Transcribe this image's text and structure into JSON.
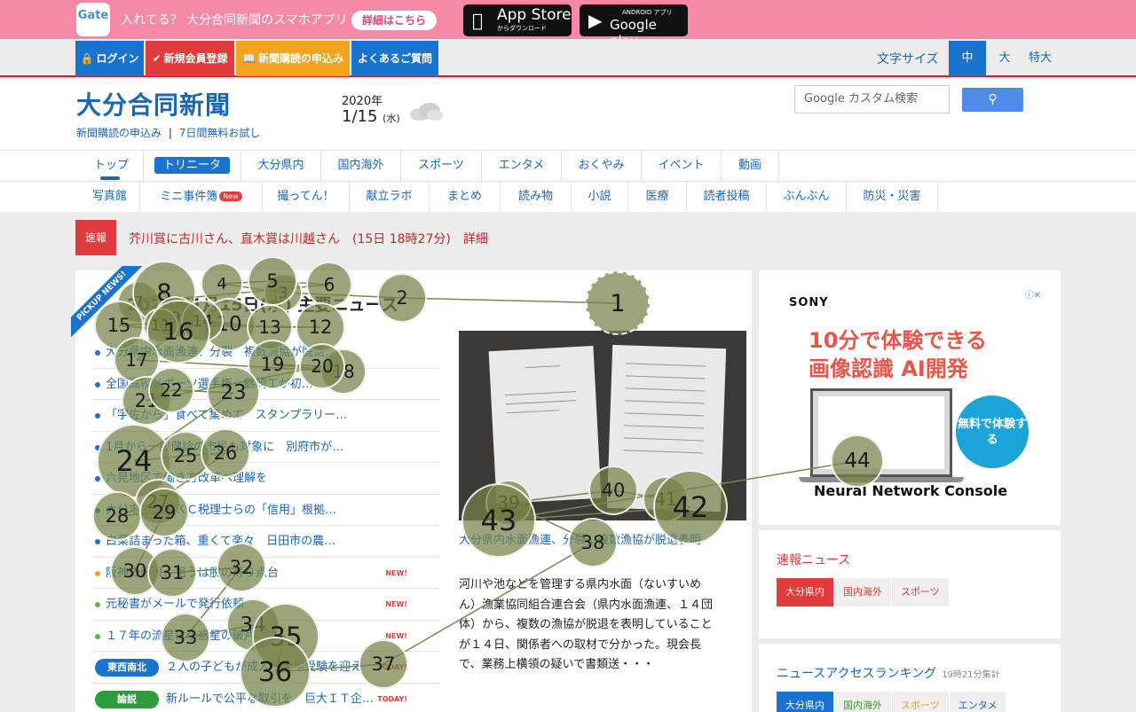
{
  "app_banner": {
    "gate_logo": "Gate",
    "text": "入れてる？ 大分合同新聞のスマホアプリ",
    "detail_button": "詳細はこちら",
    "app_store_main": "App Store",
    "app_store_sub": "からダウンロード",
    "google_play_sub": "ANDROID アプリ",
    "google_play_main": "Google play"
  },
  "top_nav": {
    "login": "ログイン",
    "register": "新規会員登録",
    "subscribe": "新聞購読の申込み",
    "faq": "よくあるご質問",
    "font_size_label": "文字サイズ",
    "font_sizes": [
      "中",
      "大",
      "特大"
    ]
  },
  "header": {
    "logo": "大分合同新聞",
    "sub_link_1": "新聞購読の申込み",
    "sub_link_2": "7日間無料お試し",
    "separator": "|",
    "year": "2020年",
    "date": "1/15",
    "weekday": "(水)",
    "search_placeholder": "カスタム検索",
    "search_brand": "Google",
    "search_button_icon": "search-icon"
  },
  "category_nav_1": [
    "トップ",
    "トリニータ",
    "大分県内",
    "国内海外",
    "スポーツ",
    "エンタメ",
    "おくやみ",
    "イベント",
    "動画"
  ],
  "category_nav_2": [
    "写真館",
    "ミニ事件簿",
    "撮ってん！",
    "献立ラボ",
    "まとめ",
    "読み物",
    "小説",
    "医療",
    "読者投稿",
    "ぶんぶん",
    "防災・災害"
  ],
  "new_badge": "New",
  "breaking": {
    "tag": "速報",
    "text": "芥川賞に古川さん、直木賞は川越さん　(15日 18時27分)",
    "detail": "詳細"
  },
  "pickup": {
    "ribbon": "PICKUP NEWS!",
    "title": "2020年1月15日(水) 主要ニュース",
    "items": [
      {
        "text": "大分県内水面漁連、分裂　複数漁協が脱退…"
      },
      {
        "text": "全国高校スポーツ選手権　鶴崎工が初…"
      },
      {
        "text": "「宇佐から」食べて集めて　スタンプラリー…"
      },
      {
        "text": "1月から一般健診の市民も対象に　別府市が…"
      },
      {
        "text": "六見地区で働き方改革へ理解を"
      },
      {
        "text": "大分市で　ＴＫＣ税理士らの「信用」根拠…"
      },
      {
        "text": "白菜詰まった箱、重くて楽々　日田市の農…"
      },
      {
        "text": "阪神の藤浪、狙うは脱の寿り点台",
        "new": "NEW!"
      },
      {
        "text": "元秘書がメールで発行依頼",
        "new": "NEW!"
      },
      {
        "text": "１７年の流星は小惑星の破片",
        "new": "NEW!"
      },
      {
        "text": "２人の子どもが成人・大学受験を迎え",
        "tag": "東西南北",
        "new": "TODAY!"
      },
      {
        "text": "新ルールで公平な取引を　巨大ＩＴ企…",
        "tag": "論説",
        "new": "TODAY!"
      }
    ],
    "photo_caption": "大分県内水面漁連、分裂　複数漁協が脱退表明",
    "photo_desc": "河川や池などを管理する県内水面（ないすいめん）漁業協同組合連合会（県内水面漁連、１４団体）から、複数の漁協が脱退を表明していることが１４日、関係者への取材で分かった。現会長で、業務上横領の疑いで書類送・・・"
  },
  "ad": {
    "brand": "SONY",
    "headline_1": "10分で体験できる",
    "headline_2": "画像認識 AI開発",
    "cta": "無料で体験する",
    "product": "Neural Network Console",
    "adchoices": "ⓘ✕"
  },
  "breaking_news_box": {
    "title": "速報ニュース",
    "tabs": [
      "大分県内",
      "国内海外",
      "スポーツ"
    ]
  },
  "ranking_box": {
    "title": "ニュースアクセスランキング",
    "subtitle": "19時21分集計",
    "tabs": [
      "大分県内",
      "国内海外",
      "スポーツ",
      "エンタメ"
    ]
  },
  "gaze_fixations": [
    "1",
    "2",
    "3",
    "4",
    "5",
    "6",
    "7",
    "8",
    "9",
    "10",
    "11",
    "12",
    "13",
    "14",
    "15",
    "16",
    "17",
    "18",
    "19",
    "20",
    "21",
    "22",
    "23",
    "24",
    "25",
    "26",
    "27",
    "28",
    "29",
    "30",
    "31",
    "32",
    "33",
    "34",
    "35",
    "36",
    "37",
    "38",
    "39",
    "40",
    "41",
    "42",
    "43",
    "44"
  ],
  "colors": {
    "app_banner": "#f48aa5",
    "brand_blue": "#1a66b8",
    "alert_red": "#e23b3b",
    "fixation": "#748248"
  }
}
